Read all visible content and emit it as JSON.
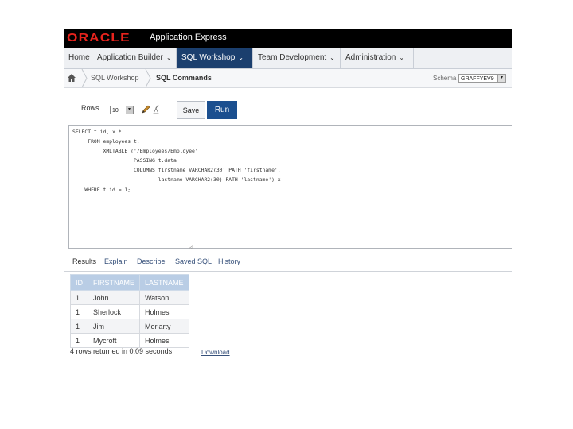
{
  "header": {
    "logo_text": "ORACLE",
    "app_title": "Application Express"
  },
  "nav": {
    "items": [
      {
        "label": "Home",
        "has_menu": false
      },
      {
        "label": "Application Builder",
        "has_menu": true
      },
      {
        "label": "SQL Workshop",
        "has_menu": true,
        "active": true
      },
      {
        "label": "Team Development",
        "has_menu": true
      },
      {
        "label": "Administration",
        "has_menu": true
      }
    ],
    "chevron": "⌄"
  },
  "breadcrumb": {
    "items": [
      "SQL Workshop",
      "SQL Commands"
    ],
    "schema_label": "Schema",
    "schema_value": "GRAFFYEV9"
  },
  "toolbar": {
    "rows_label": "Rows",
    "rows_value": "10",
    "save_label": "Save",
    "run_label": "Run"
  },
  "editor": {
    "lines": [
      "SELECT t.id, x.*",
      "     FROM employees t,",
      "          XMLTABLE ('/Employees/Employee'",
      "                    PASSING t.data",
      "                    COLUMNS firstname VARCHAR2(30) PATH 'firstname',",
      "                            lastname VARCHAR2(30) PATH 'lastname') x",
      "    WHERE t.id = 1;"
    ]
  },
  "result_tabs": [
    "Results",
    "Explain",
    "Describe",
    "Saved SQL",
    "History"
  ],
  "results": {
    "columns": [
      "ID",
      "FIRSTNAME",
      "LASTNAME"
    ],
    "rows": [
      [
        "1",
        "John",
        "Watson"
      ],
      [
        "1",
        "Sherlock",
        "Holmes"
      ],
      [
        "1",
        "Jim",
        "Moriarty"
      ],
      [
        "1",
        "Mycroft",
        "Holmes"
      ]
    ],
    "status": "4 rows returned in 0.09 seconds",
    "download_label": "Download"
  },
  "colors": {
    "brand_red": "#e8231d",
    "nav_active": "#1b3f6e",
    "run_button": "#1b4f8f",
    "table_header": "#b9cde5"
  }
}
